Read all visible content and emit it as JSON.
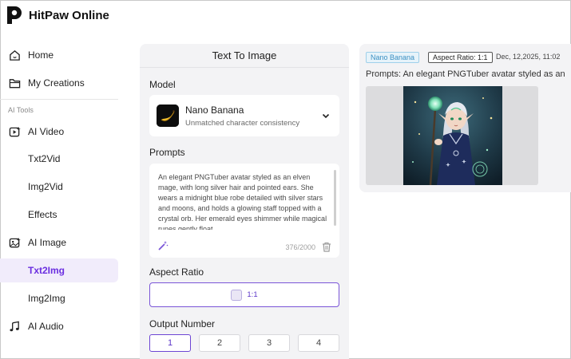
{
  "app": {
    "brand": "HitPaw Online"
  },
  "sidebar": {
    "home": "Home",
    "my_creations": "My Creations",
    "section_label": "AI Tools",
    "ai_video": "AI Video",
    "txt2vid": "Txt2Vid",
    "img2vid": "Img2Vid",
    "effects": "Effects",
    "ai_image": "AI Image",
    "txt2img": "Txt2Img",
    "img2img": "Img2Img",
    "ai_audio": "AI Audio",
    "active_item": "Txt2Img"
  },
  "panel": {
    "title": "Text To Image",
    "model_label": "Model",
    "model_name": "Nano Banana",
    "model_desc": "Unmatched character consistency",
    "prompts_label": "Prompts",
    "prompt_text": "An elegant PNGTuber avatar styled as an elven mage, with long silver hair and pointed ears. She wears a midnight blue robe detailed with silver stars and moons, and holds a glowing staff topped with a crystal orb. Her emerald eyes shimmer while magical runes gently float",
    "counter": "376/2000",
    "aspect_label": "Aspect Ratio",
    "aspect_value": "1:1",
    "output_label": "Output Number",
    "output_options": [
      "1",
      "2",
      "3",
      "4"
    ],
    "output_selected": "1"
  },
  "result": {
    "model_tag": "Nano Banana",
    "ratio_tag": "Aspect Ratio: 1:1",
    "timestamp": "Dec, 12,2025, 11:02",
    "prompt_line": "Prompts: An elegant PNGTuber avatar styled as an"
  },
  "colors": {
    "accent": "#6b2fe0",
    "active_bg": "#f1ecfb",
    "panel_bg": "#f3f3f5",
    "tag_blue": "#3a8fc2"
  }
}
